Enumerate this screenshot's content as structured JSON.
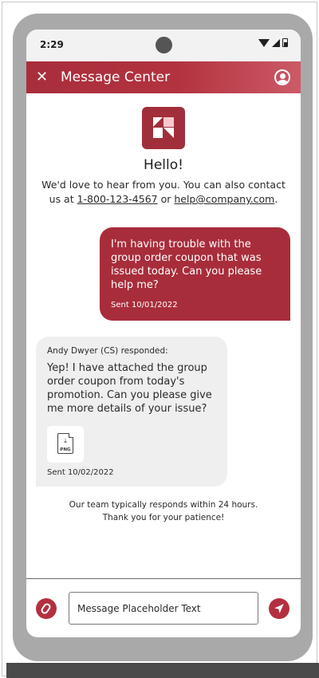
{
  "status_bar": {
    "time": "2:29"
  },
  "header": {
    "title": "Message Center",
    "close_glyph": "✕"
  },
  "welcome": {
    "greeting": "Hello!",
    "intro_prefix": "We'd love to hear from you. You can also contact us at ",
    "phone": "1-800-123-4567",
    "intro_middle": " or ",
    "email": "help@company.com",
    "intro_suffix": "."
  },
  "messages": [
    {
      "from": "user",
      "text": "I'm having trouble with the group order coupon that was issued today. Can you please help me?",
      "sent": "Sent 10/01/2022"
    },
    {
      "from": "agent",
      "responder": "Andy Dwyer (CS) responded:",
      "text": "Yep! I have attached the group order coupon from today's promotion. Can you please give me more details of your issue?",
      "attachment_type": "PNG",
      "sent": "Sent 10/02/2022"
    }
  ],
  "response_note": {
    "line1": "Our team typically responds within 24 hours.",
    "line2": "Thank you for your patience!"
  },
  "composer": {
    "placeholder": "Message Placeholder Text"
  },
  "icons": {
    "close": "close-icon",
    "profile": "profile-icon",
    "attach": "paperclip-icon",
    "send": "send-icon",
    "file": "png-file-icon"
  },
  "colors": {
    "brand": "#a82d3b",
    "agent_bubble": "#efefef"
  }
}
